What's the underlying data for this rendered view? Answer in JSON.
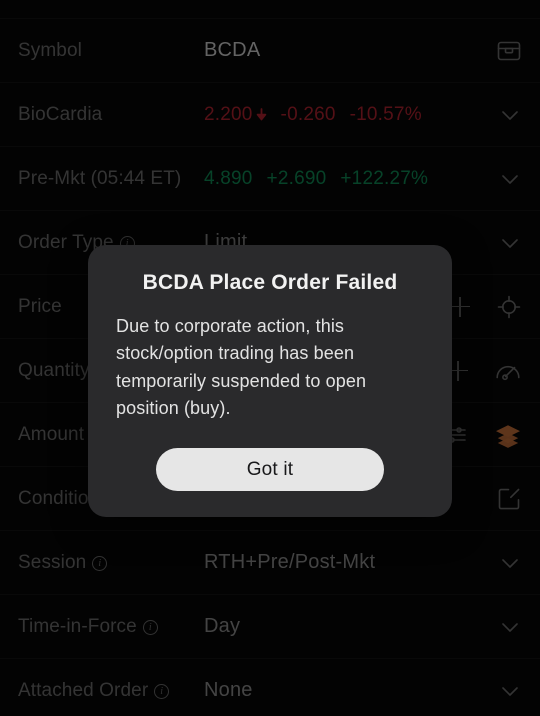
{
  "theme": {
    "background": "#070707",
    "row_divider": "#141414",
    "label_color": "#6e6e6e",
    "value_color": "#cfcfcf",
    "down_color": "#b0232e",
    "up_color": "#0f8a55",
    "accent_color": "#c5703a",
    "modal_background": "#2a2a2c",
    "button_background": "#e6e6e6",
    "button_text": "#18181a"
  },
  "form": {
    "rows": [
      {
        "id": "symbol",
        "label": "Symbol",
        "value": "BCDA",
        "right_icon": "archive-box-icon"
      },
      {
        "id": "quote",
        "label": "BioCardia",
        "quote": {
          "last": "2.200",
          "direction": "down",
          "change": "-0.260",
          "change_percent": "-10.57%"
        },
        "right_icon": "chevron-down-icon"
      },
      {
        "id": "premarket",
        "label": "Pre-Mkt (05:44 ET)",
        "quote": {
          "last": "4.890",
          "direction": "up",
          "change": "+2.690",
          "change_percent": "+122.27%"
        },
        "right_icon": "chevron-down-icon"
      },
      {
        "id": "order-type",
        "label": "Order Type",
        "has_info": true,
        "value": "Limit",
        "right_icon": "chevron-down-icon"
      },
      {
        "id": "price",
        "label": "Price",
        "has_info": false,
        "value": "",
        "right_icon": "target-icon",
        "has_plus": true
      },
      {
        "id": "quantity",
        "label": "Quantity",
        "has_info": false,
        "value": "",
        "right_icon": "gauge-icon",
        "has_plus": true
      },
      {
        "id": "amount",
        "label": "Amount",
        "has_info": false,
        "value": "",
        "right_icon": "layers-icon",
        "right_icon_accent": true,
        "has_sliders": true
      },
      {
        "id": "condition",
        "label": "Condition",
        "has_info": false,
        "value": "",
        "right_icon": "edit-square-icon"
      },
      {
        "id": "session",
        "label": "Session",
        "has_info": true,
        "value": "RTH+Pre/Post-Mkt",
        "right_icon": "chevron-down-icon"
      },
      {
        "id": "time-in-force",
        "label": "Time-in-Force",
        "has_info": true,
        "value": "Day",
        "right_icon": "chevron-down-icon"
      },
      {
        "id": "attached-order",
        "label": "Attached Order",
        "has_info": true,
        "value": "None",
        "right_icon": "chevron-down-icon"
      }
    ],
    "info_glyph": "i"
  },
  "modal": {
    "title": "BCDA Place Order Failed",
    "body": "Due to corporate action, this stock/option trading has been temporarily suspended to open position (buy).",
    "confirm_label": "Got it"
  }
}
